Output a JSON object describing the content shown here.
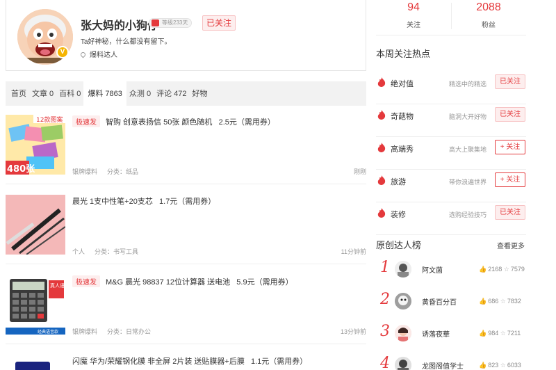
{
  "profile": {
    "name": "张大妈的小狗仔",
    "level": "等级233天",
    "follow_status": "已关注",
    "bio": "Ta好神秘，什么都没有留下。",
    "tag": "爆料达人"
  },
  "tabs": [
    {
      "label": "首页"
    },
    {
      "label": "文章 0"
    },
    {
      "label": "百科 0"
    },
    {
      "label": "爆料 7863"
    },
    {
      "label": "众测 0"
    },
    {
      "label": "评论 472"
    },
    {
      "label": "好物"
    }
  ],
  "feed": [
    {
      "badge": "极速发",
      "title": "智购 创意表扬信 50张 颜色随机",
      "price": "2.5元（需用券）",
      "source": "银牌爆料",
      "category": "分类：纸品",
      "time": "刚刚",
      "thumb_text_top": "12款图案",
      "thumb_text_bottom": "480张"
    },
    {
      "badge": "",
      "title": "晨光 1支中性笔+20支芯",
      "price": "1.7元（需用券）",
      "source": "个人",
      "category": "分类：书写工具",
      "time": "11分钟前"
    },
    {
      "badge": "极速发",
      "title": "M&G 晨光 98837 12位计算器 送电池",
      "price": "5.9元（需用券）",
      "source": "银牌爆料",
      "category": "分类：日常办公",
      "time": "13分钟前",
      "thumb_text_top": "真人语音",
      "thumb_text_bottom": "经典语音款"
    },
    {
      "badge": "",
      "title": "闪魔 华为/荣耀钢化膜 非全屏 2片装 送贴膜器+后膜",
      "price": "1.1元（需用券）"
    }
  ],
  "stats": {
    "following_num": "94",
    "following_label": "关注",
    "fans_num": "2088",
    "fans_label": "粉丝"
  },
  "hot_section": {
    "title": "本周关注热点",
    "items": [
      {
        "name": "绝对值",
        "desc": "精选中的精选",
        "button": "已关注"
      },
      {
        "name": "奇葩物",
        "desc": "脑洞大开好物",
        "button": "已关注"
      },
      {
        "name": "高端秀",
        "desc": "高大上聚集地",
        "button": "+ 关注"
      },
      {
        "name": "旅游",
        "desc": "带你浪遍世界",
        "button": "+ 关注"
      },
      {
        "name": "装修",
        "desc": "选购经验技巧",
        "button": "已关注"
      }
    ]
  },
  "rank_section": {
    "title": "原创达人榜",
    "see_more": "查看更多",
    "items": [
      {
        "rank": "1",
        "name": "阿文菌",
        "likes": "2168",
        "stars": "7579"
      },
      {
        "rank": "2",
        "name": "黄昏百分百",
        "likes": "686",
        "stars": "7832"
      },
      {
        "rank": "3",
        "name": "诱落夜華",
        "likes": "984",
        "stars": "7211"
      },
      {
        "rank": "4",
        "name": "龙图阁值学士",
        "likes": "823",
        "stars": "6033"
      }
    ]
  },
  "colors": {
    "accent": "#e4393c",
    "accent_light": "#fdeeee"
  }
}
